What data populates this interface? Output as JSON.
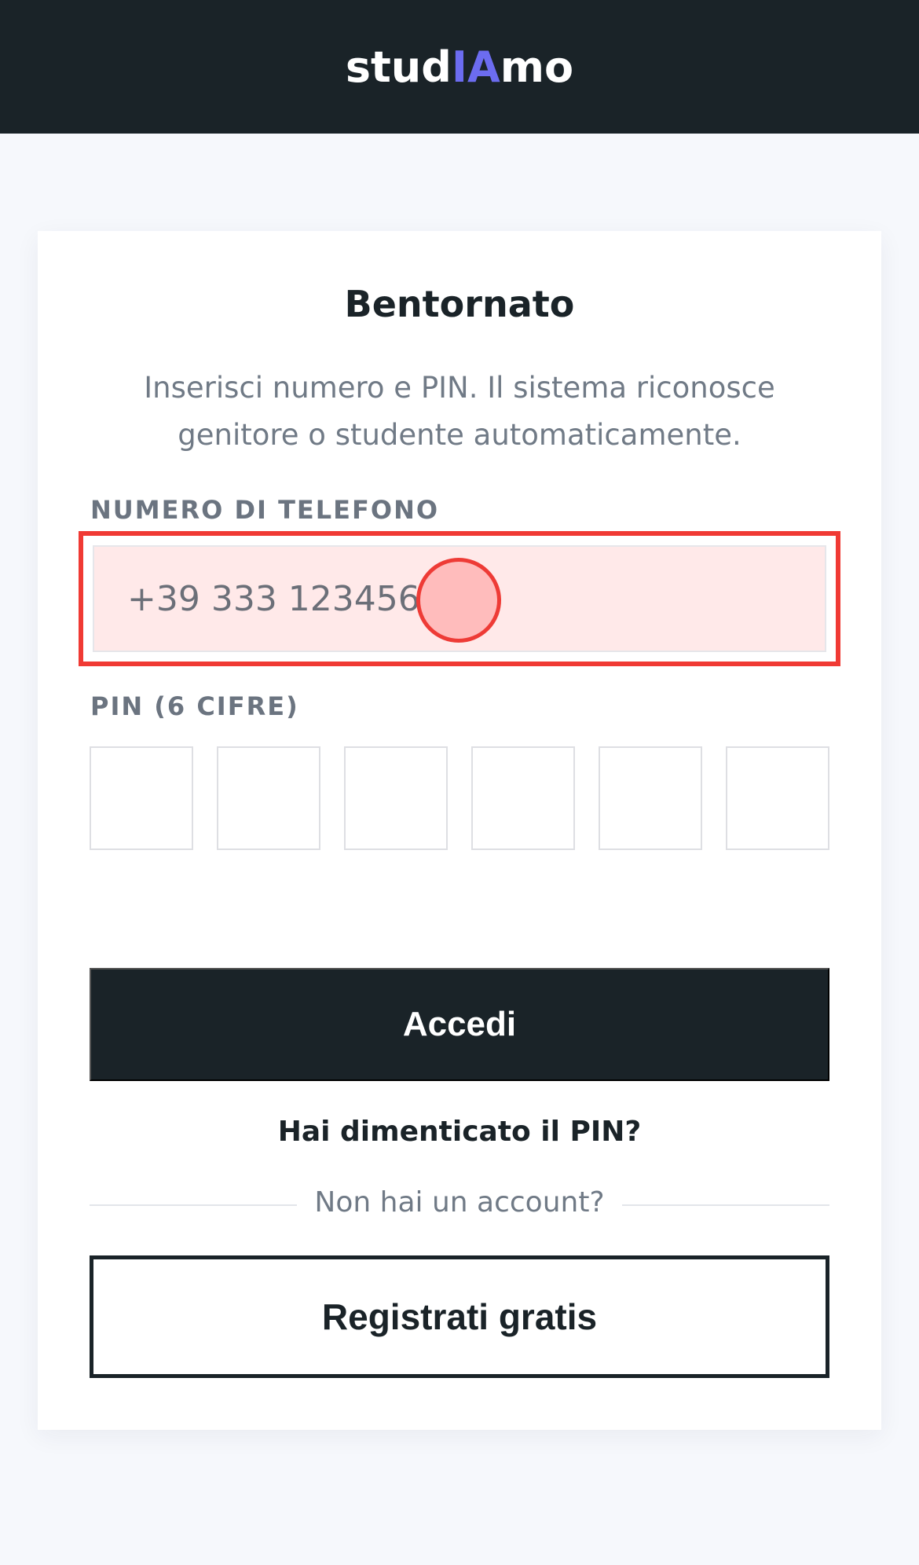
{
  "header": {
    "brand_prefix": "stud",
    "brand_accent": "IA",
    "brand_suffix": "mo"
  },
  "login": {
    "title": "Bentornato",
    "subtitle": "Inserisci numero e PIN. Il sistema riconosce genitore o studente automaticamente.",
    "phone_label": "NUMERO DI TELEFONO",
    "phone_placeholder": "+39 333 1234567",
    "pin_label": "PIN (6 CIFRE)",
    "pin_digits": [
      "",
      "",
      "",
      "",
      "",
      ""
    ],
    "submit_label": "Accedi",
    "forgot_label": "Hai dimenticato il PIN?",
    "divider_text": "Non hai un account?",
    "register_label": "Registrati gratis"
  },
  "colors": {
    "header_bg": "#1a2328",
    "brand_accent": "#6c6cf0",
    "highlight": "#f03a34",
    "page_bg": "#f6f8fc"
  }
}
